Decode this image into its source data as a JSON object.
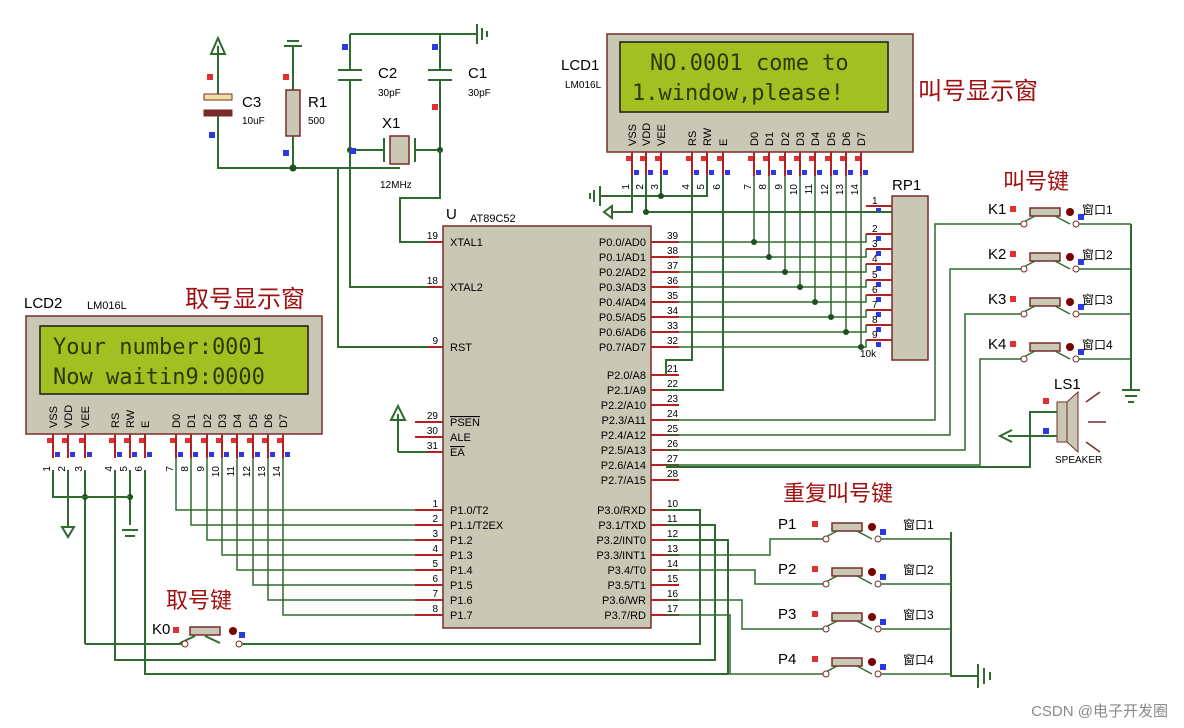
{
  "lcd1": {
    "ref": "LCD1",
    "model": "LM016L",
    "line1": "NO.0001 come to",
    "line2": "1.window,please!",
    "caption": "叫号显示窗",
    "pins": [
      "VSS",
      "VDD",
      "VEE",
      "RS",
      "RW",
      "E",
      "D0",
      "D1",
      "D2",
      "D3",
      "D4",
      "D5",
      "D6",
      "D7"
    ],
    "pin_numbers": [
      "1",
      "2",
      "3",
      "4",
      "5",
      "6",
      "7",
      "8",
      "9",
      "10",
      "11",
      "12",
      "13",
      "14"
    ]
  },
  "lcd2": {
    "ref": "LCD2",
    "model": "LM016L",
    "line1": "Your number:0001",
    "line2": "Now waitin9:0000",
    "caption": "取号显示窗",
    "pins": [
      "VSS",
      "VDD",
      "VEE",
      "RS",
      "RW",
      "E",
      "D0",
      "D1",
      "D2",
      "D3",
      "D4",
      "D5",
      "D6",
      "D7"
    ],
    "pin_numbers": [
      "1",
      "2",
      "3",
      "4",
      "5",
      "6",
      "7",
      "8",
      "9",
      "10",
      "11",
      "12",
      "13",
      "14"
    ]
  },
  "mcu": {
    "ref": "U",
    "model": "AT89C52",
    "left_pins": [
      {
        "num": "19",
        "name": "XTAL1"
      },
      {
        "num": "18",
        "name": "XTAL2"
      },
      {
        "num": "9",
        "name": "RST"
      },
      {
        "num": "29",
        "name": "PSEN"
      },
      {
        "num": "30",
        "name": "ALE"
      },
      {
        "num": "31",
        "name": "EA"
      },
      {
        "num": "1",
        "name": "P1.0/T2"
      },
      {
        "num": "2",
        "name": "P1.1/T2EX"
      },
      {
        "num": "3",
        "name": "P1.2"
      },
      {
        "num": "4",
        "name": "P1.3"
      },
      {
        "num": "5",
        "name": "P1.4"
      },
      {
        "num": "6",
        "name": "P1.5"
      },
      {
        "num": "7",
        "name": "P1.6"
      },
      {
        "num": "8",
        "name": "P1.7"
      }
    ],
    "right_pins": [
      {
        "num": "39",
        "name": "P0.0/AD0"
      },
      {
        "num": "38",
        "name": "P0.1/AD1"
      },
      {
        "num": "37",
        "name": "P0.2/AD2"
      },
      {
        "num": "36",
        "name": "P0.3/AD3"
      },
      {
        "num": "35",
        "name": "P0.4/AD4"
      },
      {
        "num": "34",
        "name": "P0.5/AD5"
      },
      {
        "num": "33",
        "name": "P0.6/AD6"
      },
      {
        "num": "32",
        "name": "P0.7/AD7"
      },
      {
        "num": "21",
        "name": "P2.0/A8"
      },
      {
        "num": "22",
        "name": "P2.1/A9"
      },
      {
        "num": "23",
        "name": "P2.2/A10"
      },
      {
        "num": "24",
        "name": "P2.3/A11"
      },
      {
        "num": "25",
        "name": "P2.4/A12"
      },
      {
        "num": "26",
        "name": "P2.5/A13"
      },
      {
        "num": "27",
        "name": "P2.6/A14"
      },
      {
        "num": "28",
        "name": "P2.7/A15"
      },
      {
        "num": "10",
        "name": "P3.0/RXD"
      },
      {
        "num": "11",
        "name": "P3.1/TXD"
      },
      {
        "num": "12",
        "name": "P3.2/INT0"
      },
      {
        "num": "13",
        "name": "P3.3/INT1"
      },
      {
        "num": "14",
        "name": "P3.4/T0"
      },
      {
        "num": "15",
        "name": "P3.5/T1"
      },
      {
        "num": "16",
        "name": "P3.6/WR"
      },
      {
        "num": "17",
        "name": "P3.7/RD"
      }
    ]
  },
  "c3": {
    "ref": "C3",
    "value": "10uF"
  },
  "r1": {
    "ref": "R1",
    "value": "500"
  },
  "c2": {
    "ref": "C2",
    "value": "30pF"
  },
  "c1": {
    "ref": "C1",
    "value": "30pF"
  },
  "x1": {
    "ref": "X1",
    "value": "12MHz"
  },
  "rp1": {
    "ref": "RP1",
    "value": "10k",
    "pin_numbers": [
      "1",
      "2",
      "3",
      "4",
      "5",
      "6",
      "7",
      "8",
      "9"
    ]
  },
  "ls1": {
    "ref": "LS1",
    "model": "SPEAKER"
  },
  "call_keys": {
    "caption": "叫号键",
    "keys": [
      {
        "ref": "K1",
        "label": "窗口1"
      },
      {
        "ref": "K2",
        "label": "窗口2"
      },
      {
        "ref": "K3",
        "label": "窗口3"
      },
      {
        "ref": "K4",
        "label": "窗口4"
      }
    ]
  },
  "repeat_keys": {
    "caption": "重复叫号键",
    "keys": [
      {
        "ref": "P1",
        "label": "窗口1"
      },
      {
        "ref": "P2",
        "label": "窗口2"
      },
      {
        "ref": "P3",
        "label": "窗口3"
      },
      {
        "ref": "P4",
        "label": "窗口4"
      }
    ]
  },
  "take_key": {
    "caption": "取号键",
    "ref": "K0"
  },
  "watermark": "CSDN @电子开发圈"
}
